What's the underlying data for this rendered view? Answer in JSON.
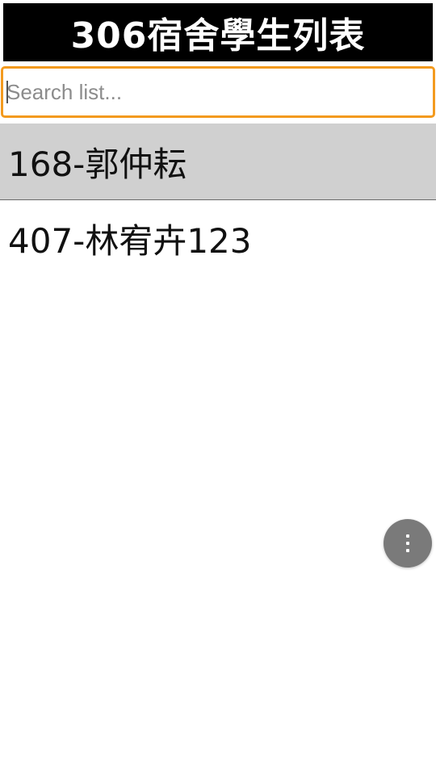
{
  "header": {
    "title": "306宿舍學生列表"
  },
  "search": {
    "placeholder": "Search list...",
    "value": ""
  },
  "list": {
    "items": [
      {
        "label": "168-郭仲耘",
        "selected": true
      },
      {
        "label": "407-林宥卉123",
        "selected": false
      }
    ]
  },
  "fab": {
    "icon": "more-vertical-icon"
  },
  "colors": {
    "title_bg": "#000000",
    "search_border": "#f39a1e",
    "selected_row_bg": "#d0d0d0",
    "fab_bg": "#7a7a7a"
  }
}
